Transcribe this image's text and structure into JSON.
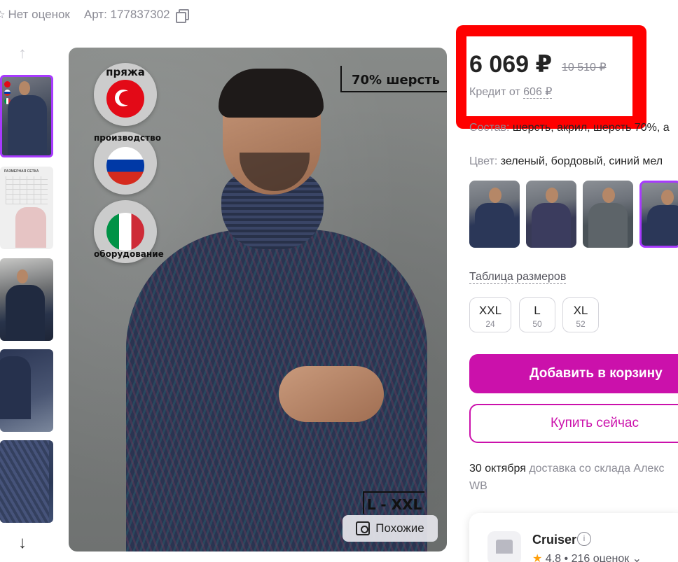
{
  "top": {
    "rating_text": "Нет оценок",
    "article": "Арт: 177837302"
  },
  "gallery": {
    "badges": [
      "пряжа",
      "производство",
      "оборудование"
    ],
    "wool_label": "70% шерсть",
    "size_label": "L - XXL",
    "similar_button": "Похожие",
    "size_thumb_label": "РАЗМЕРНАЯ СЕТКА"
  },
  "price": {
    "current": "6 069 ₽",
    "old": "10 510 ₽",
    "credit_prefix": "Кредит от",
    "credit_value": "606 ₽"
  },
  "details": {
    "composition_key": "Состав:",
    "composition_value": "шерсть, акрил, шерсть 70%, а",
    "color_key": "Цвет:",
    "color_value": "зеленый, бордовый, синий мел",
    "size_table_link": "Таблица размеров"
  },
  "sizes": [
    {
      "size": "XXL",
      "ru": "24"
    },
    {
      "size": "L",
      "ru": "50"
    },
    {
      "size": "XL",
      "ru": "52"
    }
  ],
  "actions": {
    "add_to_cart": "Добавить в корзину",
    "buy_now": "Купить сейчас"
  },
  "delivery": {
    "date": "30 октября",
    "text": "доставка со склада Алекс WB"
  },
  "seller": {
    "name": "Cruiser",
    "rating": "4.8",
    "reviews": "216 оценок"
  },
  "colors": {
    "accent": "#cb11ab",
    "selection": "#a73afd",
    "highlight_box": "#ff0000"
  }
}
